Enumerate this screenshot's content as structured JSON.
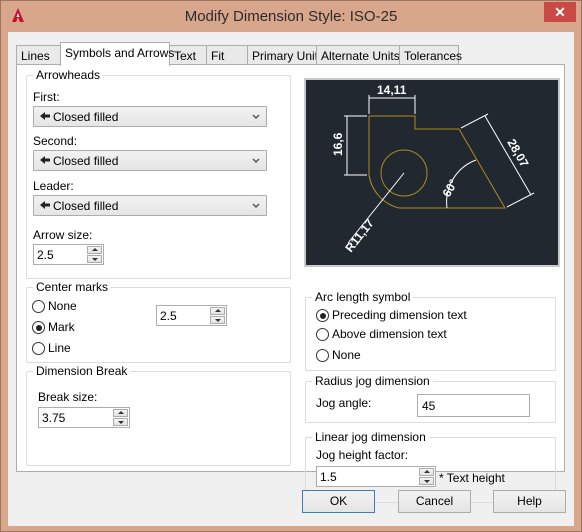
{
  "window": {
    "title": "Modify Dimension Style: ISO-25",
    "close_label": "✕",
    "icon": "autocad-app-icon"
  },
  "tabs": [
    {
      "label": "Lines",
      "active": false
    },
    {
      "label": "Symbols and Arrows",
      "active": true
    },
    {
      "label": "Text",
      "active": false
    },
    {
      "label": "Fit",
      "active": false
    },
    {
      "label": "Primary Units",
      "active": false
    },
    {
      "label": "Alternate Units",
      "active": false
    },
    {
      "label": "Tolerances",
      "active": false
    }
  ],
  "arrowheads": {
    "legend": "Arrowheads",
    "first_label": "First:",
    "first_value": "Closed filled",
    "second_label": "Second:",
    "second_value": "Closed filled",
    "leader_label": "Leader:",
    "leader_value": "Closed filled",
    "arrow_size_label": "Arrow size:",
    "arrow_size_value": "2.5"
  },
  "center_marks": {
    "legend": "Center marks",
    "options": [
      {
        "label": "None",
        "checked": false
      },
      {
        "label": "Mark",
        "checked": true
      },
      {
        "label": "Line",
        "checked": false
      }
    ],
    "size_value": "2.5"
  },
  "dimension_break": {
    "legend": "Dimension Break",
    "break_size_label": "Break size:",
    "break_size_value": "3.75"
  },
  "preview": {
    "dim_top": "14,11",
    "dim_left": "16,6",
    "dim_right": "28,07",
    "dim_angle": "60°",
    "dim_radius": "R11,17",
    "colors": {
      "background": "#212830",
      "geometry": "#b08a1e",
      "dimension": "#ffffff"
    }
  },
  "arc_length": {
    "legend": "Arc length symbol",
    "options": [
      {
        "label": "Preceding dimension text",
        "checked": true
      },
      {
        "label": "Above dimension text",
        "checked": false
      },
      {
        "label": "None",
        "checked": false
      }
    ]
  },
  "radius_jog": {
    "legend": "Radius jog dimension",
    "jog_angle_label": "Jog angle:",
    "jog_angle_value": "45"
  },
  "linear_jog": {
    "legend": "Linear jog dimension",
    "height_factor_label": "Jog height factor:",
    "height_factor_value": "1.5",
    "suffix": "* Text height"
  },
  "buttons": {
    "ok": "OK",
    "cancel": "Cancel",
    "help": "Help"
  }
}
